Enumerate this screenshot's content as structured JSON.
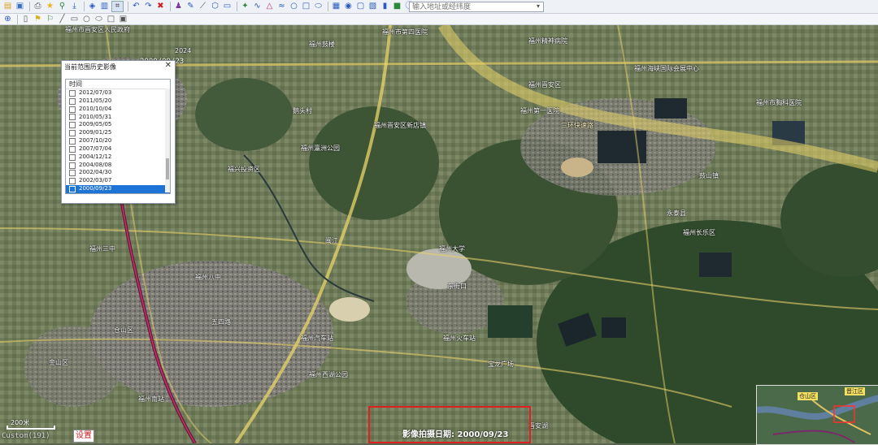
{
  "toolbar": {
    "search_placeholder": "输入地址或经纬度",
    "row1_icons": [
      "open-icon",
      "save-icon",
      "print-icon",
      "favorite-icon",
      "pin-icon",
      "download-icon",
      "layer-icon",
      "history-image-icon",
      "select-icon",
      "undo-icon",
      "redo-icon",
      "delete-icon",
      "person-icon",
      "edit-icon",
      "ruler-icon",
      "polygon-icon",
      "camera-icon",
      "marker-icon",
      "line-icon",
      "triangle-icon",
      "path-icon",
      "circle-icon",
      "rect-icon",
      "ellipse-icon",
      "grid-icon",
      "search-map-icon",
      "import-icon",
      "export-icon",
      "stats-icon",
      "chat-icon",
      "info-icon",
      "help-icon"
    ],
    "row2_icons": [
      "target-icon",
      "doc-icon",
      "pin2-icon",
      "flag-icon",
      "line2-icon",
      "rect2-icon",
      "circle2-icon",
      "ellipse2-icon",
      "square-icon",
      "image-icon"
    ]
  },
  "panel": {
    "title": "当前范围历史影像",
    "column_header": "时间",
    "dates": [
      "2012/07/03",
      "2011/05/20",
      "2010/10/04",
      "2010/05/31",
      "2009/05/05",
      "2009/01/25",
      "2007/10/20",
      "2007/07/04",
      "2004/12/12",
      "2004/08/08",
      "2002/04/30",
      "2002/03/07",
      "2000/09/23"
    ],
    "selected_date": "2000/09/23"
  },
  "map": {
    "top_date": "2000/09/23",
    "top_year": "2024",
    "labels": [
      "福州市第四医院",
      "福州精神病院",
      "福州市晋安区人民政府",
      "福州鼓楼",
      "福州海峡国际会展中心",
      "三环快速路",
      "福州晋安区",
      "鹅头村",
      "福州晋安区新店镇",
      "福州第一医院",
      "福州市胸科医院",
      "鼓山镇",
      "福州瀛洲公园",
      "福兴投资区",
      "福州长乐区",
      "永泰县",
      "福州大学",
      "福州三中",
      "福州八中",
      "闽江",
      "福州汽车站",
      "福州火车站",
      "东街口",
      "五四路",
      "宝龙广场",
      "仓山区",
      "金山区",
      "福州西湖公园",
      "晋安湖",
      "福州南站"
    ],
    "scale_label": "200米",
    "coords": "Custom(191)",
    "settings_label": "设置",
    "capture_date_label": "影像拍摄日期: 2000/09/23",
    "minimap_labels": [
      "仓山区",
      "晋江区"
    ]
  }
}
